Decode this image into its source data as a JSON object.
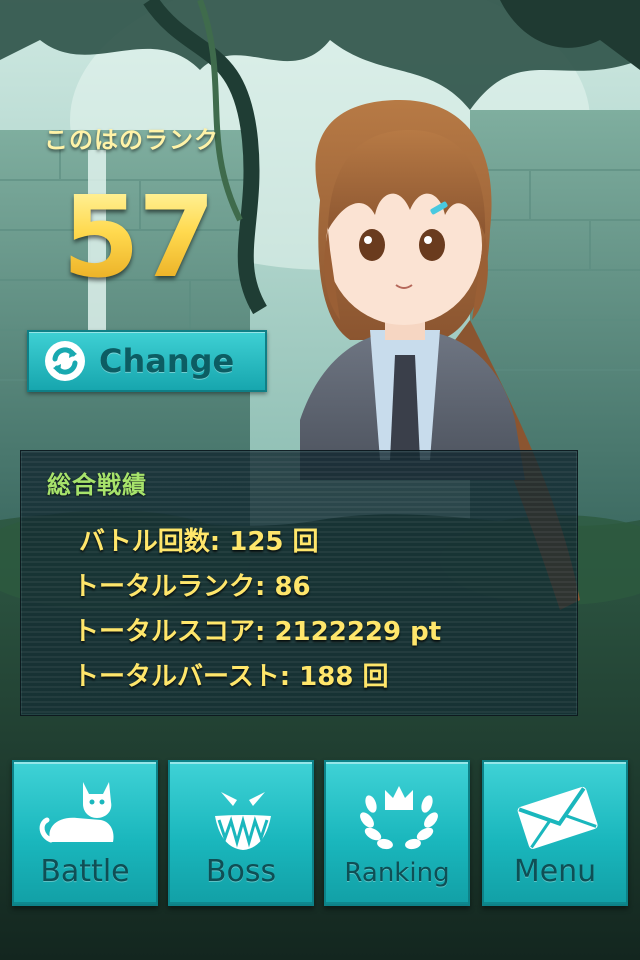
{
  "rank": {
    "label": "このはのランク",
    "value": "57",
    "change_button_label": "Change"
  },
  "stats": {
    "title": "総合戦績",
    "rows": [
      "バトル回数: 125 回",
      "トータルランク: 86",
      "トータルスコア: 2122229 pt",
      "トータルバースト: 188 回"
    ]
  },
  "nav": {
    "battle_label": "Battle",
    "boss_label": "Boss",
    "ranking_label": "Ranking",
    "menu_label": "Menu"
  },
  "colors": {
    "button_teal": "#1ab7bd",
    "rank_gold": "#ffd64a",
    "stats_text": "#ffe66b",
    "stats_title": "#a7e36b"
  },
  "icons": [
    "refresh-icon",
    "cat-icon",
    "boss-face-icon",
    "crown-laurel-icon",
    "envelope-icon"
  ]
}
